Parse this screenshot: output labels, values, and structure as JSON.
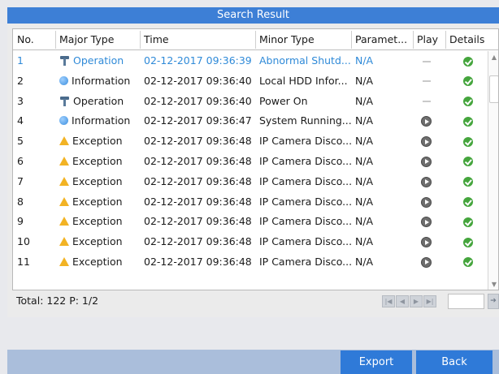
{
  "window": {
    "title": "Search Result"
  },
  "table": {
    "headers": {
      "no": "No.",
      "major": "Major Type",
      "time": "Time",
      "minor": "Minor Type",
      "param": "Paramet...",
      "play": "Play",
      "details": "Details"
    },
    "rows": [
      {
        "no": "1",
        "major": "Operation",
        "icon": "operation-icon",
        "time": "02-12-2017 09:36:39",
        "minor": "Abnormal Shutd...",
        "param": "N/A",
        "play": "none",
        "selected": true
      },
      {
        "no": "2",
        "major": "Information",
        "icon": "information-icon",
        "time": "02-12-2017 09:36:40",
        "minor": "Local HDD Infor...",
        "param": "N/A",
        "play": "none",
        "selected": false
      },
      {
        "no": "3",
        "major": "Operation",
        "icon": "operation-icon",
        "time": "02-12-2017 09:36:40",
        "minor": "Power On",
        "param": "N/A",
        "play": "none",
        "selected": false
      },
      {
        "no": "4",
        "major": "Information",
        "icon": "information-icon",
        "time": "02-12-2017 09:36:47",
        "minor": "System Running...",
        "param": "N/A",
        "play": "play",
        "selected": false
      },
      {
        "no": "5",
        "major": "Exception",
        "icon": "warning-icon",
        "time": "02-12-2017 09:36:48",
        "minor": "IP Camera Disco...",
        "param": "N/A",
        "play": "play",
        "selected": false
      },
      {
        "no": "6",
        "major": "Exception",
        "icon": "warning-icon",
        "time": "02-12-2017 09:36:48",
        "minor": "IP Camera Disco...",
        "param": "N/A",
        "play": "play",
        "selected": false
      },
      {
        "no": "7",
        "major": "Exception",
        "icon": "warning-icon",
        "time": "02-12-2017 09:36:48",
        "minor": "IP Camera Disco...",
        "param": "N/A",
        "play": "play",
        "selected": false
      },
      {
        "no": "8",
        "major": "Exception",
        "icon": "warning-icon",
        "time": "02-12-2017 09:36:48",
        "minor": "IP Camera Disco...",
        "param": "N/A",
        "play": "play",
        "selected": false
      },
      {
        "no": "9",
        "major": "Exception",
        "icon": "warning-icon",
        "time": "02-12-2017 09:36:48",
        "minor": "IP Camera Disco...",
        "param": "N/A",
        "play": "play",
        "selected": false
      },
      {
        "no": "10",
        "major": "Exception",
        "icon": "warning-icon",
        "time": "02-12-2017 09:36:48",
        "minor": "IP Camera Disco...",
        "param": "N/A",
        "play": "play",
        "selected": false
      },
      {
        "no": "11",
        "major": "Exception",
        "icon": "warning-icon",
        "time": "02-12-2017 09:36:48",
        "minor": "IP Camera Disco...",
        "param": "N/A",
        "play": "play",
        "selected": false
      }
    ]
  },
  "footer": {
    "total": "Total: 122  P: 1/2",
    "page_input": ""
  },
  "buttons": {
    "export": "Export",
    "back": "Back"
  },
  "colors": {
    "accent": "#2f7ad8",
    "title_bar": "#3d7fd6",
    "selected_text": "#2f8ad8",
    "ok": "#45a53d",
    "warning": "#f2b324"
  }
}
